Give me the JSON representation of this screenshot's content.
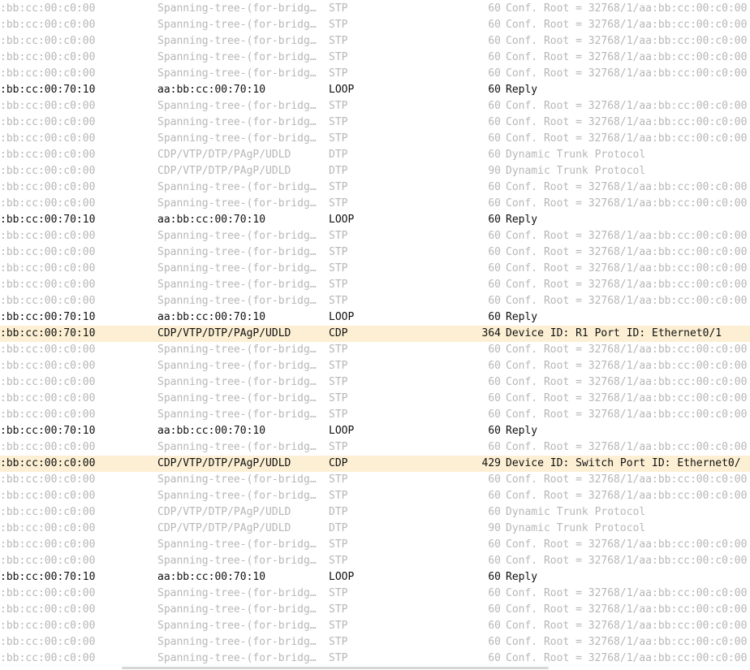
{
  "packet_list": {
    "rows": [
      {
        "source": ":bb:cc:00:c0:00",
        "destination": "Spanning-tree-(for-bridg…",
        "protocol": "STP",
        "length": "60",
        "info": "Conf. Root = 32768/1/aa:bb:cc:00:c0:00",
        "style": "gray"
      },
      {
        "source": ":bb:cc:00:c0:00",
        "destination": "Spanning-tree-(for-bridg…",
        "protocol": "STP",
        "length": "60",
        "info": "Conf. Root = 32768/1/aa:bb:cc:00:c0:00",
        "style": "gray"
      },
      {
        "source": ":bb:cc:00:c0:00",
        "destination": "Spanning-tree-(for-bridg…",
        "protocol": "STP",
        "length": "60",
        "info": "Conf. Root = 32768/1/aa:bb:cc:00:c0:00",
        "style": "gray"
      },
      {
        "source": ":bb:cc:00:c0:00",
        "destination": "Spanning-tree-(for-bridg…",
        "protocol": "STP",
        "length": "60",
        "info": "Conf. Root = 32768/1/aa:bb:cc:00:c0:00",
        "style": "gray"
      },
      {
        "source": ":bb:cc:00:c0:00",
        "destination": "Spanning-tree-(for-bridg…",
        "protocol": "STP",
        "length": "60",
        "info": "Conf. Root = 32768/1/aa:bb:cc:00:c0:00",
        "style": "gray"
      },
      {
        "source": ":bb:cc:00:70:10",
        "destination": "aa:bb:cc:00:70:10",
        "protocol": "LOOP",
        "length": "60",
        "info": "Reply",
        "style": "dark"
      },
      {
        "source": ":bb:cc:00:c0:00",
        "destination": "Spanning-tree-(for-bridg…",
        "protocol": "STP",
        "length": "60",
        "info": "Conf. Root = 32768/1/aa:bb:cc:00:c0:00",
        "style": "gray"
      },
      {
        "source": ":bb:cc:00:c0:00",
        "destination": "Spanning-tree-(for-bridg…",
        "protocol": "STP",
        "length": "60",
        "info": "Conf. Root = 32768/1/aa:bb:cc:00:c0:00",
        "style": "gray"
      },
      {
        "source": ":bb:cc:00:c0:00",
        "destination": "Spanning-tree-(for-bridg…",
        "protocol": "STP",
        "length": "60",
        "info": "Conf. Root = 32768/1/aa:bb:cc:00:c0:00",
        "style": "gray"
      },
      {
        "source": ":bb:cc:00:c0:00",
        "destination": "CDP/VTP/DTP/PAgP/UDLD",
        "protocol": "DTP",
        "length": "60",
        "info": "Dynamic Trunk Protocol",
        "style": "gray"
      },
      {
        "source": ":bb:cc:00:c0:00",
        "destination": "CDP/VTP/DTP/PAgP/UDLD",
        "protocol": "DTP",
        "length": "90",
        "info": "Dynamic Trunk Protocol",
        "style": "gray"
      },
      {
        "source": ":bb:cc:00:c0:00",
        "destination": "Spanning-tree-(for-bridg…",
        "protocol": "STP",
        "length": "60",
        "info": "Conf. Root = 32768/1/aa:bb:cc:00:c0:00",
        "style": "gray"
      },
      {
        "source": ":bb:cc:00:c0:00",
        "destination": "Spanning-tree-(for-bridg…",
        "protocol": "STP",
        "length": "60",
        "info": "Conf. Root = 32768/1/aa:bb:cc:00:c0:00",
        "style": "gray"
      },
      {
        "source": ":bb:cc:00:70:10",
        "destination": "aa:bb:cc:00:70:10",
        "protocol": "LOOP",
        "length": "60",
        "info": "Reply",
        "style": "dark"
      },
      {
        "source": ":bb:cc:00:c0:00",
        "destination": "Spanning-tree-(for-bridg…",
        "protocol": "STP",
        "length": "60",
        "info": "Conf. Root = 32768/1/aa:bb:cc:00:c0:00",
        "style": "gray"
      },
      {
        "source": ":bb:cc:00:c0:00",
        "destination": "Spanning-tree-(for-bridg…",
        "protocol": "STP",
        "length": "60",
        "info": "Conf. Root = 32768/1/aa:bb:cc:00:c0:00",
        "style": "gray"
      },
      {
        "source": ":bb:cc:00:c0:00",
        "destination": "Spanning-tree-(for-bridg…",
        "protocol": "STP",
        "length": "60",
        "info": "Conf. Root = 32768/1/aa:bb:cc:00:c0:00",
        "style": "gray"
      },
      {
        "source": ":bb:cc:00:c0:00",
        "destination": "Spanning-tree-(for-bridg…",
        "protocol": "STP",
        "length": "60",
        "info": "Conf. Root = 32768/1/aa:bb:cc:00:c0:00",
        "style": "gray"
      },
      {
        "source": ":bb:cc:00:c0:00",
        "destination": "Spanning-tree-(for-bridg…",
        "protocol": "STP",
        "length": "60",
        "info": "Conf. Root = 32768/1/aa:bb:cc:00:c0:00",
        "style": "gray"
      },
      {
        "source": ":bb:cc:00:70:10",
        "destination": "aa:bb:cc:00:70:10",
        "protocol": "LOOP",
        "length": "60",
        "info": "Reply",
        "style": "dark"
      },
      {
        "source": ":bb:cc:00:70:10",
        "destination": "CDP/VTP/DTP/PAgP/UDLD",
        "protocol": "CDP",
        "length": "364",
        "info": "Device ID: R1  Port ID: Ethernet0/1",
        "style": "cdp"
      },
      {
        "source": ":bb:cc:00:c0:00",
        "destination": "Spanning-tree-(for-bridg…",
        "protocol": "STP",
        "length": "60",
        "info": "Conf. Root = 32768/1/aa:bb:cc:00:c0:00",
        "style": "gray"
      },
      {
        "source": ":bb:cc:00:c0:00",
        "destination": "Spanning-tree-(for-bridg…",
        "protocol": "STP",
        "length": "60",
        "info": "Conf. Root = 32768/1/aa:bb:cc:00:c0:00",
        "style": "gray"
      },
      {
        "source": ":bb:cc:00:c0:00",
        "destination": "Spanning-tree-(for-bridg…",
        "protocol": "STP",
        "length": "60",
        "info": "Conf. Root = 32768/1/aa:bb:cc:00:c0:00",
        "style": "gray"
      },
      {
        "source": ":bb:cc:00:c0:00",
        "destination": "Spanning-tree-(for-bridg…",
        "protocol": "STP",
        "length": "60",
        "info": "Conf. Root = 32768/1/aa:bb:cc:00:c0:00",
        "style": "gray"
      },
      {
        "source": ":bb:cc:00:c0:00",
        "destination": "Spanning-tree-(for-bridg…",
        "protocol": "STP",
        "length": "60",
        "info": "Conf. Root = 32768/1/aa:bb:cc:00:c0:00",
        "style": "gray"
      },
      {
        "source": ":bb:cc:00:70:10",
        "destination": "aa:bb:cc:00:70:10",
        "protocol": "LOOP",
        "length": "60",
        "info": "Reply",
        "style": "dark"
      },
      {
        "source": ":bb:cc:00:c0:00",
        "destination": "Spanning-tree-(for-bridg…",
        "protocol": "STP",
        "length": "60",
        "info": "Conf. Root = 32768/1/aa:bb:cc:00:c0:00",
        "style": "gray"
      },
      {
        "source": ":bb:cc:00:c0:00",
        "destination": "CDP/VTP/DTP/PAgP/UDLD",
        "protocol": "CDP",
        "length": "429",
        "info": "Device ID: Switch  Port ID: Ethernet0/",
        "style": "cdp"
      },
      {
        "source": ":bb:cc:00:c0:00",
        "destination": "Spanning-tree-(for-bridg…",
        "protocol": "STP",
        "length": "60",
        "info": "Conf. Root = 32768/1/aa:bb:cc:00:c0:00",
        "style": "gray"
      },
      {
        "source": ":bb:cc:00:c0:00",
        "destination": "Spanning-tree-(for-bridg…",
        "protocol": "STP",
        "length": "60",
        "info": "Conf. Root = 32768/1/aa:bb:cc:00:c0:00",
        "style": "gray"
      },
      {
        "source": ":bb:cc:00:c0:00",
        "destination": "CDP/VTP/DTP/PAgP/UDLD",
        "protocol": "DTP",
        "length": "60",
        "info": "Dynamic Trunk Protocol",
        "style": "gray"
      },
      {
        "source": ":bb:cc:00:c0:00",
        "destination": "CDP/VTP/DTP/PAgP/UDLD",
        "protocol": "DTP",
        "length": "90",
        "info": "Dynamic Trunk Protocol",
        "style": "gray"
      },
      {
        "source": ":bb:cc:00:c0:00",
        "destination": "Spanning-tree-(for-bridg…",
        "protocol": "STP",
        "length": "60",
        "info": "Conf. Root = 32768/1/aa:bb:cc:00:c0:00",
        "style": "gray"
      },
      {
        "source": ":bb:cc:00:c0:00",
        "destination": "Spanning-tree-(for-bridg…",
        "protocol": "STP",
        "length": "60",
        "info": "Conf. Root = 32768/1/aa:bb:cc:00:c0:00",
        "style": "gray"
      },
      {
        "source": ":bb:cc:00:70:10",
        "destination": "aa:bb:cc:00:70:10",
        "protocol": "LOOP",
        "length": "60",
        "info": "Reply",
        "style": "dark"
      },
      {
        "source": ":bb:cc:00:c0:00",
        "destination": "Spanning-tree-(for-bridg…",
        "protocol": "STP",
        "length": "60",
        "info": "Conf. Root = 32768/1/aa:bb:cc:00:c0:00",
        "style": "gray"
      },
      {
        "source": ":bb:cc:00:c0:00",
        "destination": "Spanning-tree-(for-bridg…",
        "protocol": "STP",
        "length": "60",
        "info": "Conf. Root = 32768/1/aa:bb:cc:00:c0:00",
        "style": "gray"
      },
      {
        "source": ":bb:cc:00:c0:00",
        "destination": "Spanning-tree-(for-bridg…",
        "protocol": "STP",
        "length": "60",
        "info": "Conf. Root = 32768/1/aa:bb:cc:00:c0:00",
        "style": "gray"
      },
      {
        "source": ":bb:cc:00:c0:00",
        "destination": "Spanning-tree-(for-bridg…",
        "protocol": "STP",
        "length": "60",
        "info": "Conf. Root = 32768/1/aa:bb:cc:00:c0:00",
        "style": "gray"
      },
      {
        "source": ":bb:cc:00:c0:00",
        "destination": "Spanning-tree-(for-bridg…",
        "protocol": "STP",
        "length": "60",
        "info": "Conf. Root = 32768/1/aa:bb:cc:00:c0:00",
        "style": "gray"
      }
    ]
  },
  "colors": {
    "row_gray_text": "#b7b7b7",
    "row_dark_text": "#111111",
    "cdp_row_background": "#fcefd3"
  }
}
